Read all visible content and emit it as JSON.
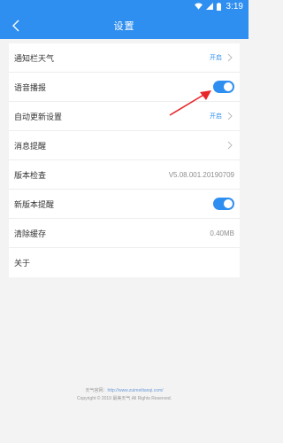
{
  "status_bar": {
    "time": "3:19"
  },
  "header": {
    "title": "设置"
  },
  "settings": {
    "notification_weather": {
      "label": "通知栏天气",
      "value": "开启"
    },
    "voice_broadcast": {
      "label": "语音播报",
      "enabled": true
    },
    "auto_update": {
      "label": "自动更新设置",
      "value": "开启"
    },
    "message_alerts": {
      "label": "消息提醒"
    },
    "version_check": {
      "label": "版本检查",
      "value": "V5.08.001.20190709"
    },
    "new_version_alert": {
      "label": "新版本提醒",
      "enabled": true
    },
    "clear_cache": {
      "label": "清除缓存",
      "value": "0.40MB"
    },
    "about": {
      "label": "关于"
    }
  },
  "footer": {
    "site_label": "天气官网：",
    "site_url": "http://www.zuimeitianqi.com/",
    "copyright": "Copyright © 2019 最美天气 All Rights Reserved."
  },
  "colors": {
    "accent": "#2f8ff0",
    "annotation_arrow": "#e8262a"
  }
}
